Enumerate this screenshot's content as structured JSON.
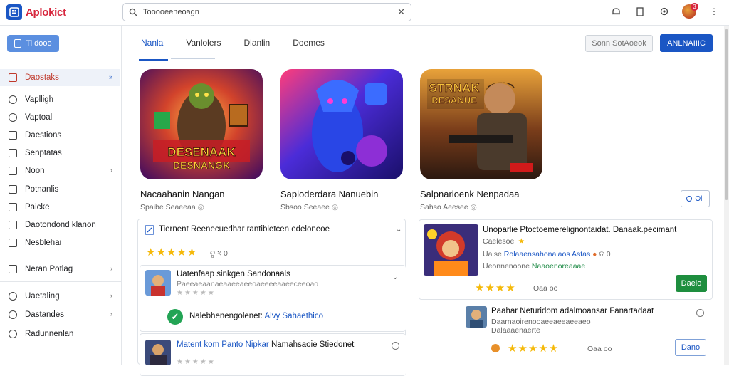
{
  "app": {
    "logo_letter": "⛶",
    "name": "Aplokict"
  },
  "search": {
    "value": "Tooooeeneoagn"
  },
  "sidebar": {
    "new_label": "Ti dooo",
    "items": [
      {
        "label": "Daostaks",
        "icon": "flag-icon",
        "active": true,
        "chevron": "»"
      },
      {
        "label": "Vaplligh",
        "icon": "lightbulb-icon"
      },
      {
        "label": "Vaptoal",
        "icon": "chat-icon"
      },
      {
        "label": "Daestions",
        "icon": "calendar-icon"
      },
      {
        "label": "Senptatas",
        "icon": "square-icon"
      },
      {
        "label": "Noon",
        "icon": "list-icon",
        "chevron": "›"
      },
      {
        "label": "Potnanlis",
        "icon": "square-icon"
      },
      {
        "label": "Paicke",
        "icon": "square-icon"
      },
      {
        "label": "Daotondond klanon",
        "icon": "square-icon"
      },
      {
        "label": "Nesblehai",
        "icon": "grid-icon"
      },
      {
        "label": "Neran Potlag",
        "icon": "folder-icon",
        "chevron": "›"
      },
      {
        "label": "Uaetaling",
        "icon": "circle-icon",
        "chevron": "›"
      },
      {
        "label": "Dastandes",
        "icon": "globe-icon",
        "chevron": "›"
      },
      {
        "label": "Radunnenlan",
        "icon": "search-icon"
      }
    ]
  },
  "tabs": [
    "Nanla",
    "Vanlolers",
    "Dlanlin",
    "Doemes"
  ],
  "actions": {
    "secondary": "Sonn SotAoeok",
    "primary": "ANLNAIIIC"
  },
  "games": [
    {
      "title": "Nacaahanin Nangan",
      "sub": "Spaibe Seaeeaa",
      "art_text": "DESENAAK DESNANGK",
      "palette": [
        "#ff7a1a",
        "#8b1fa8"
      ]
    },
    {
      "title": "Saploderdara Nanuebin",
      "sub": "Sbsoo Seeaee",
      "art_text": "",
      "palette": [
        "#2b2fe0",
        "#e0306a"
      ]
    },
    {
      "title": "Salpnarioenk Nenpadaa",
      "sub": "Sahso Aeesee",
      "art_text": "STRNAK RESANUE",
      "palette": [
        "#f0a030",
        "#3a2416"
      ]
    }
  ],
  "chip": {
    "label": "Oll"
  },
  "left_card": {
    "header": "Tiernent Reenecuedhar rantibletcen edeloneoe",
    "rating_stars": "★★★★★",
    "rating_meta": "ତୃ ঽ 0",
    "row1_title": "Uatenfaap sinkgen Sandonaals",
    "row1_sub": "Paeeaeaanaeaaeeaeeoaeeeeaaeeceeoao",
    "row1_stars": "★★★★★",
    "row2_text": "Nalebhenengolenet:",
    "row2_link": "Alvy Sahaethico",
    "row3_title_link": "Matent kom Panto Nipkar",
    "row3_title": "Namahsaoie Stiedonet",
    "row3_stars": "★★★★★"
  },
  "right_card": {
    "title": "Unoparlie Ptoctoemerelignontaidat. Danaak.pecimant",
    "sub": "Caelesoel",
    "sub_star": "★",
    "line": "Ualse",
    "line_link": "Rolaaensahonaiaos Astas",
    "line_meta": "ତ 0",
    "status_prefix": "Ueonnenoone",
    "status_green": "Naaoenoreaaae",
    "rating_stars": "★★★★",
    "rating_meta": "Oaa oo",
    "install_label": "Daeio",
    "sub_title": "Paahar Neturidom adalmoansar Fanartadaat",
    "sub_line": "Daarnaoirenooaeeaeeaeeaeo",
    "sub_line2": "Dalaaaenaerte",
    "sub_stars": "★★★★★",
    "sub_meta": "Oaa oo",
    "open_label": "Dano"
  }
}
